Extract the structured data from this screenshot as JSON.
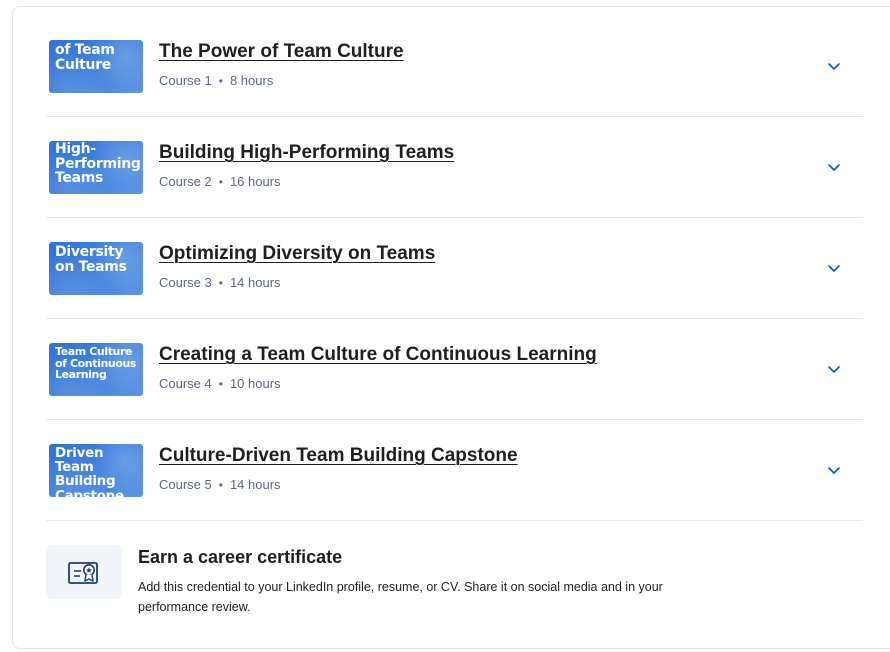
{
  "courses": [
    {
      "thumb_text": "of Team\nCulture",
      "title": "The Power of Team Culture",
      "number": "Course 1",
      "separator": "•",
      "duration": "8 hours",
      "thumb_icon": "course-thumbnail-image",
      "expand_icon": "chevron-down-icon"
    },
    {
      "thumb_text": "High-\nPerforming\nTeams",
      "title": "Building High-Performing Teams",
      "number": "Course 2",
      "separator": "•",
      "duration": "16 hours",
      "thumb_icon": "course-thumbnail-image",
      "expand_icon": "chevron-down-icon"
    },
    {
      "thumb_text": "Diversity\non Teams",
      "title": "Optimizing Diversity on Teams",
      "number": "Course 3",
      "separator": "•",
      "duration": "14 hours",
      "thumb_icon": "course-thumbnail-image",
      "expand_icon": "chevron-down-icon"
    },
    {
      "thumb_text": "Team Culture\nof Continuous\nLearning",
      "title": "Creating a Team Culture of Continuous Learning",
      "number": "Course 4",
      "separator": "•",
      "duration": "10 hours",
      "thumb_icon": "course-thumbnail-image",
      "expand_icon": "chevron-down-icon"
    },
    {
      "thumb_text": "Driven Team\nBuilding\nCapstone",
      "title": "Culture-Driven Team Building Capstone",
      "number": "Course 5",
      "separator": "•",
      "duration": "14 hours",
      "thumb_icon": "course-thumbnail-image",
      "expand_icon": "chevron-down-icon"
    }
  ],
  "certificate": {
    "title": "Earn a career certificate",
    "description": "Add this credential to your LinkedIn profile, resume, or CV. Share it on social media and in your performance review.",
    "icon": "certificate-icon"
  },
  "colors": {
    "thumbnail_blue": "#2f73d6",
    "chevron_blue": "#0056d2",
    "meta_gray": "#5b6780",
    "divider": "#e1e5ea",
    "cert_icon_bg": "#f1f5fa"
  }
}
